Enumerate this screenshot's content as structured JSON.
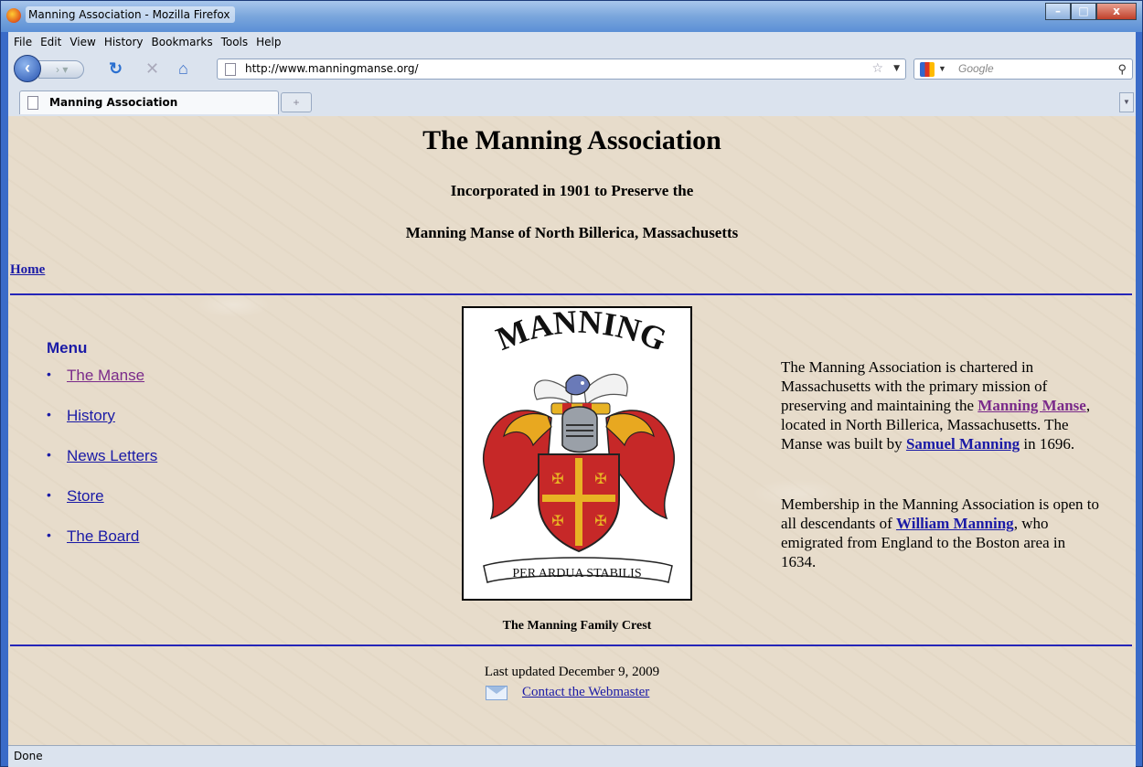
{
  "window": {
    "title": "Manning Association - Mozilla Firefox",
    "controls": {
      "minimize": "–",
      "maximize": "□",
      "close": "x"
    }
  },
  "menubar": [
    "File",
    "Edit",
    "View",
    "History",
    "Bookmarks",
    "Tools",
    "Help"
  ],
  "navbar": {
    "url": "http://www.manningmanse.org/",
    "search_placeholder": "Google"
  },
  "tabs": [
    {
      "label": "Manning Association",
      "active": true
    }
  ],
  "page": {
    "title": "The Manning Association",
    "subtitle1": "Incorporated in 1901 to Preserve the",
    "subtitle2": "Manning Manse of North Billerica, Massachusetts",
    "home_link": "Home",
    "menu": {
      "title": "Menu",
      "items": [
        {
          "label": "The Manse",
          "visited": true
        },
        {
          "label": "History",
          "visited": false
        },
        {
          "label": "News Letters",
          "visited": false
        },
        {
          "label": "Store",
          "visited": false
        },
        {
          "label": "The Board",
          "visited": false
        }
      ]
    },
    "crest": {
      "banner_top": "MANNING",
      "motto": "PER ARDUA STABILIS",
      "caption": "The Manning Family Crest"
    },
    "paragraph1": {
      "text_a": "The Manning Association is chartered in Massachusetts with the primary mission of preserving and maintaining the ",
      "link_manse": "Manning Manse",
      "text_b": ", located in North Billerica, Massachusetts. The Manse was built by ",
      "link_samuel": "Samuel Manning",
      "text_c": " in 1696."
    },
    "paragraph2": {
      "text_a": "Membership in the Manning Association is open to all descendants of ",
      "link_william": "William Manning",
      "text_b": ", who emigrated from England to the Boston area in 1634."
    },
    "footer": {
      "updated": "Last updated December 9, 2009",
      "contact": "Contact the Webmaster"
    }
  },
  "status": "Done",
  "colors": {
    "link": "#1a1aa6",
    "visited": "#7a2a8a",
    "background": "#e7dccb",
    "rule": "#2525b8"
  }
}
